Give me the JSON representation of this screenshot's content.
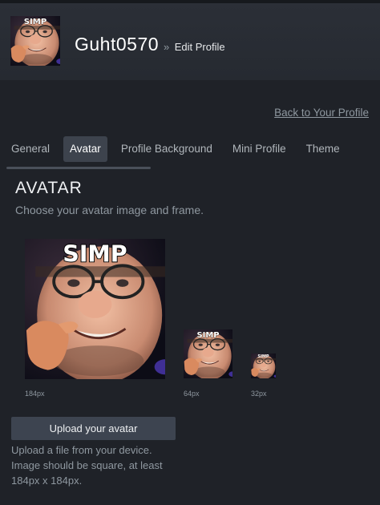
{
  "header": {
    "username": "Guht0570",
    "breadcrumb_sep": "»",
    "breadcrumb_current": "Edit Profile",
    "avatar_caption": "SIMP"
  },
  "nav": {
    "back_link": "Back to Your Profile",
    "tabs": [
      {
        "label": "General",
        "active": false
      },
      {
        "label": "Avatar",
        "active": true
      },
      {
        "label": "Profile Background",
        "active": false
      },
      {
        "label": "Mini Profile",
        "active": false
      },
      {
        "label": "Theme",
        "active": false
      }
    ]
  },
  "avatar_section": {
    "title": "AVATAR",
    "subtitle": "Choose your avatar image and frame.",
    "image_caption": "SIMP",
    "previews": [
      {
        "size_label": "184px"
      },
      {
        "size_label": "64px"
      },
      {
        "size_label": "32px"
      }
    ],
    "upload_button": "Upload your avatar",
    "upload_help": "Upload a file from your device. Image should be square, at least 184px x 184px."
  },
  "colors": {
    "background": "#1f2228",
    "header_bg": "#2b2f37",
    "active_tab_bg": "#3d434d",
    "button_bg": "#3d4450",
    "muted_text": "#8f98a0"
  }
}
